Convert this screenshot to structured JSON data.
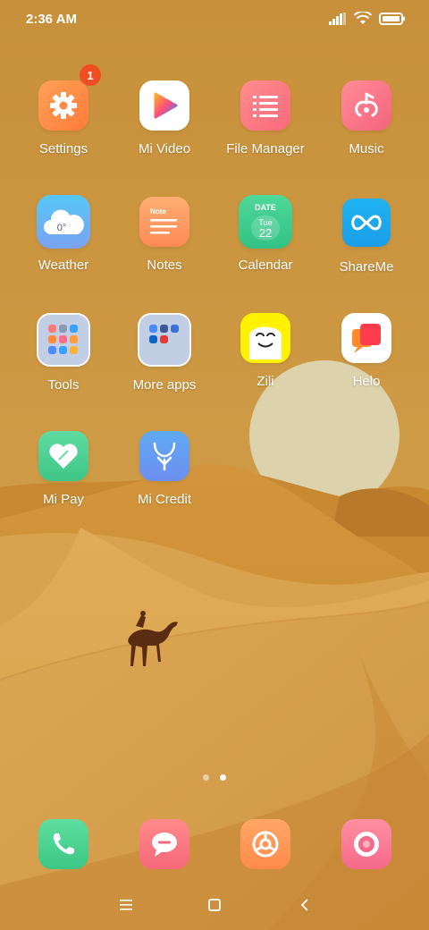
{
  "status_bar": {
    "time": "2:36 AM"
  },
  "apps": [
    {
      "name": "settings",
      "label": "Settings",
      "badge": "1"
    },
    {
      "name": "mi-video",
      "label": "Mi Video"
    },
    {
      "name": "file-manager",
      "label": "File Manager"
    },
    {
      "name": "music",
      "label": "Music"
    },
    {
      "name": "weather",
      "label": "Weather",
      "temp": "0°"
    },
    {
      "name": "notes",
      "label": "Notes",
      "icon_text": "Note"
    },
    {
      "name": "calendar",
      "label": "Calendar",
      "icon_header": "DATE",
      "weekday": "Tue",
      "day": "22"
    },
    {
      "name": "shareme",
      "label": "ShareMe"
    },
    {
      "name": "tools",
      "label": "Tools"
    },
    {
      "name": "more-apps",
      "label": "More apps"
    },
    {
      "name": "zili",
      "label": "Zili"
    },
    {
      "name": "helo",
      "label": "Helo"
    },
    {
      "name": "mi-pay",
      "label": "Mi Pay"
    },
    {
      "name": "mi-credit",
      "label": "Mi Credit"
    }
  ],
  "dock": [
    {
      "name": "phone-icon"
    },
    {
      "name": "messages-icon"
    },
    {
      "name": "browser-icon"
    },
    {
      "name": "camera-icon"
    }
  ],
  "page_indicator": {
    "count": 2,
    "active": 2
  },
  "colors": {
    "sky": "#c8923a",
    "sun": "#dcd3ad",
    "badge": "#ef4e22"
  }
}
